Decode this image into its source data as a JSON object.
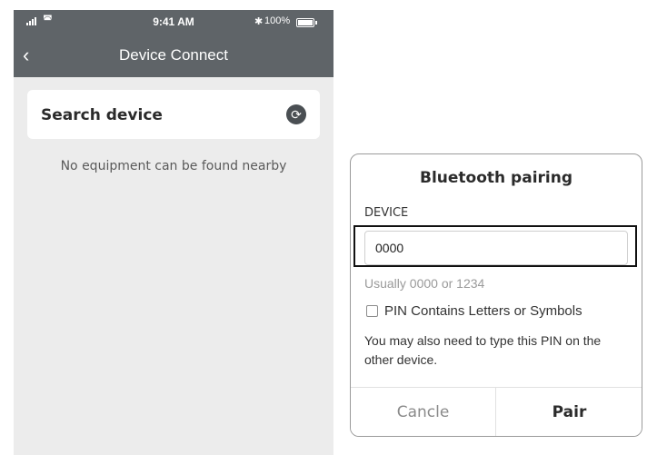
{
  "phone": {
    "status_bar": {
      "time": "9:41 AM",
      "bluetooth_icon": "✱",
      "battery": "100%"
    },
    "nav": {
      "back_icon": "‹",
      "title": "Device Connect"
    },
    "search_card": {
      "label": "Search device",
      "refresh_icon": "⟳"
    },
    "empty_message": "No equipment can be found nearby"
  },
  "dialog": {
    "title": "Bluetooth pairing",
    "device_label": "DEVICE",
    "pin_value": "0000",
    "hint": "Usually 0000 or 1234",
    "checkbox_label": "PIN Contains Letters or Symbols",
    "note": "You may also need to type this PIN on the other device.",
    "cancel_label": "Cancle",
    "pair_label": "Pair"
  },
  "colors": {
    "nav_bar": "#5f6468",
    "screen_background": "#ececec",
    "refresh_icon": "#4a4f53",
    "highlight_border": "#111111"
  }
}
